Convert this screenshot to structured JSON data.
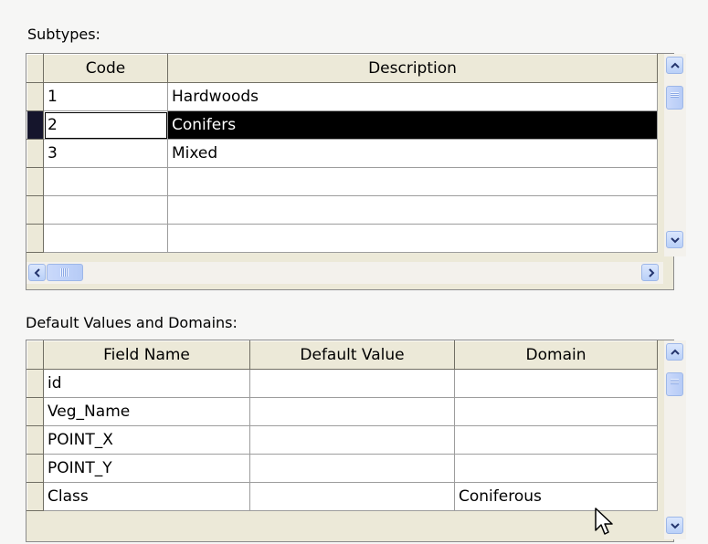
{
  "subtypes": {
    "label": "Subtypes:",
    "columns": [
      "Code",
      "Description"
    ],
    "rows": [
      {
        "code": "1",
        "description": "Hardwoods"
      },
      {
        "code": "2",
        "description": "Conifers"
      },
      {
        "code": "3",
        "description": "Mixed"
      },
      {
        "code": "",
        "description": ""
      },
      {
        "code": "",
        "description": ""
      },
      {
        "code": "",
        "description": ""
      }
    ],
    "selected_row": 2
  },
  "defaults": {
    "label": "Default Values and Domains:",
    "columns": [
      "Field Name",
      "Default Value",
      "Domain"
    ],
    "rows": [
      {
        "field": "id",
        "default": "",
        "domain": ""
      },
      {
        "field": "Veg_Name",
        "default": "",
        "domain": ""
      },
      {
        "field": "POINT_X",
        "default": "",
        "domain": ""
      },
      {
        "field": "POINT_Y",
        "default": "",
        "domain": ""
      },
      {
        "field": "Class",
        "default": "",
        "domain": "Coniferous"
      }
    ]
  },
  "icons": {
    "scroll_up": "chevron-up-icon",
    "scroll_down": "chevron-down-icon",
    "scroll_left": "chevron-left-icon",
    "scroll_right": "chevron-right-icon",
    "cursor": "mouse-pointer-icon"
  },
  "colors": {
    "selection": "#000000",
    "header": "#ece9d8",
    "scroll_button": "#c1d3fb"
  }
}
